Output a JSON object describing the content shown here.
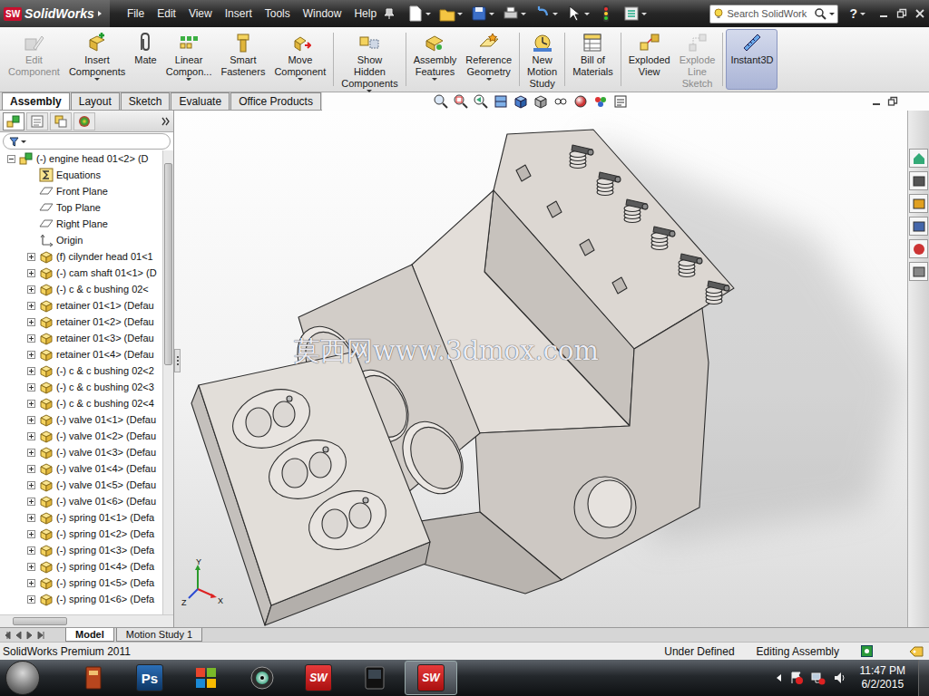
{
  "app": {
    "badge": "SW",
    "name": "SolidWorks"
  },
  "menu": [
    "File",
    "Edit",
    "View",
    "Insert",
    "Tools",
    "Window",
    "Help"
  ],
  "search": {
    "placeholder": "Search SolidWork"
  },
  "help": "?",
  "commands": [
    {
      "lines": [
        "Edit",
        "Component"
      ],
      "kind": "edit",
      "group": 1,
      "dropdown": false,
      "disabled": true,
      "selected": false
    },
    {
      "lines": [
        "Insert",
        "Components"
      ],
      "kind": "insert",
      "group": 1,
      "dropdown": true,
      "disabled": false,
      "selected": false
    },
    {
      "lines": [
        "Mate"
      ],
      "kind": "mate",
      "group": 1,
      "dropdown": false,
      "disabled": false,
      "selected": false
    },
    {
      "lines": [
        "Linear",
        "Compon..."
      ],
      "kind": "pattern",
      "group": 1,
      "dropdown": true,
      "disabled": false,
      "selected": false
    },
    {
      "lines": [
        "Smart",
        "Fasteners"
      ],
      "kind": "fastener",
      "group": 1,
      "dropdown": false,
      "disabled": false,
      "selected": false
    },
    {
      "lines": [
        "Move",
        "Component"
      ],
      "kind": "move",
      "group": 1,
      "dropdown": true,
      "disabled": false,
      "selected": false
    },
    {
      "lines": [
        "Show",
        "Hidden",
        "Components"
      ],
      "kind": "show",
      "group": 2,
      "dropdown": true,
      "disabled": false,
      "selected": false
    },
    {
      "lines": [
        "Assembly",
        "Features"
      ],
      "kind": "features",
      "group": 3,
      "dropdown": true,
      "disabled": false,
      "selected": false
    },
    {
      "lines": [
        "Reference",
        "Geometry"
      ],
      "kind": "reference",
      "group": 3,
      "dropdown": true,
      "disabled": false,
      "selected": false
    },
    {
      "lines": [
        "New",
        "Motion",
        "Study"
      ],
      "kind": "motion",
      "group": 4,
      "dropdown": false,
      "disabled": false,
      "selected": false
    },
    {
      "lines": [
        "Bill of",
        "Materials"
      ],
      "kind": "bom",
      "group": 5,
      "dropdown": false,
      "disabled": false,
      "selected": false
    },
    {
      "lines": [
        "Exploded",
        "View"
      ],
      "kind": "explode",
      "group": 6,
      "dropdown": false,
      "disabled": false,
      "selected": false
    },
    {
      "lines": [
        "Explode",
        "Line",
        "Sketch"
      ],
      "kind": "line",
      "group": 6,
      "dropdown": false,
      "disabled": true,
      "selected": false
    },
    {
      "lines": [
        "Instant3D"
      ],
      "kind": "instant",
      "group": 7,
      "dropdown": false,
      "disabled": false,
      "selected": true
    }
  ],
  "tabs": [
    {
      "label": "Assembly",
      "selected": true
    },
    {
      "label": "Layout",
      "selected": false
    },
    {
      "label": "Sketch",
      "selected": false
    },
    {
      "label": "Evaluate",
      "selected": false
    },
    {
      "label": "Office Products",
      "selected": false
    }
  ],
  "tree": [
    {
      "label": "(-) engine head 01<2> (D",
      "kind": "root",
      "level": 0,
      "expandable": true,
      "expanded": true
    },
    {
      "label": "Equations",
      "kind": "equations",
      "level": 1,
      "expandable": false,
      "expanded": false
    },
    {
      "label": "Front Plane",
      "kind": "plane",
      "level": 1,
      "expandable": false,
      "expanded": false
    },
    {
      "label": "Top Plane",
      "kind": "plane",
      "level": 1,
      "expandable": false,
      "expanded": false
    },
    {
      "label": "Right Plane",
      "kind": "plane",
      "level": 1,
      "expandable": false,
      "expanded": false
    },
    {
      "label": "Origin",
      "kind": "origin",
      "level": 1,
      "expandable": false,
      "expanded": false
    },
    {
      "label": "(f) cilynder head 01<1",
      "kind": "part",
      "level": 1,
      "expandable": true,
      "expanded": false
    },
    {
      "label": "(-) cam shaft 01<1> (D",
      "kind": "part",
      "level": 1,
      "expandable": true,
      "expanded": false
    },
    {
      "label": "(-) c & c bushing 02<",
      "kind": "part",
      "level": 1,
      "expandable": true,
      "expanded": false
    },
    {
      "label": "retainer 01<1> (Defau",
      "kind": "part",
      "level": 1,
      "expandable": true,
      "expanded": false
    },
    {
      "label": "retainer 01<2> (Defau",
      "kind": "part",
      "level": 1,
      "expandable": true,
      "expanded": false
    },
    {
      "label": "retainer 01<3> (Defau",
      "kind": "part",
      "level": 1,
      "expandable": true,
      "expanded": false
    },
    {
      "label": "retainer 01<4> (Defau",
      "kind": "part",
      "level": 1,
      "expandable": true,
      "expanded": false
    },
    {
      "label": "(-) c & c bushing 02<2",
      "kind": "part",
      "level": 1,
      "expandable": true,
      "expanded": false
    },
    {
      "label": "(-) c & c bushing 02<3",
      "kind": "part",
      "level": 1,
      "expandable": true,
      "expanded": false
    },
    {
      "label": "(-) c & c bushing 02<4",
      "kind": "part",
      "level": 1,
      "expandable": true,
      "expanded": false
    },
    {
      "label": "(-) valve 01<1> (Defau",
      "kind": "part",
      "level": 1,
      "expandable": true,
      "expanded": false
    },
    {
      "label": "(-) valve 01<2> (Defau",
      "kind": "part",
      "level": 1,
      "expandable": true,
      "expanded": false
    },
    {
      "label": "(-) valve 01<3> (Defau",
      "kind": "part",
      "level": 1,
      "expandable": true,
      "expanded": false
    },
    {
      "label": "(-) valve 01<4> (Defau",
      "kind": "part",
      "level": 1,
      "expandable": true,
      "expanded": false
    },
    {
      "label": "(-) valve 01<5> (Defau",
      "kind": "part",
      "level": 1,
      "expandable": true,
      "expanded": false
    },
    {
      "label": "(-) valve 01<6> (Defau",
      "kind": "part",
      "level": 1,
      "expandable": true,
      "expanded": false
    },
    {
      "label": "(-) spring 01<1> (Defa",
      "kind": "part",
      "level": 1,
      "expandable": true,
      "expanded": false
    },
    {
      "label": "(-) spring 01<2> (Defa",
      "kind": "part",
      "level": 1,
      "expandable": true,
      "expanded": false
    },
    {
      "label": "(-) spring 01<3> (Defa",
      "kind": "part",
      "level": 1,
      "expandable": true,
      "expanded": false
    },
    {
      "label": "(-) spring 01<4> (Defa",
      "kind": "part",
      "level": 1,
      "expandable": true,
      "expanded": false
    },
    {
      "label": "(-) spring 01<5> (Defa",
      "kind": "part",
      "level": 1,
      "expandable": true,
      "expanded": false
    },
    {
      "label": "(-) spring 01<6> (Defa",
      "kind": "part",
      "level": 1,
      "expandable": true,
      "expanded": false
    }
  ],
  "watermark": "莫西网www.3dmox.com",
  "triad": {
    "y": "Y",
    "x": "X",
    "z": "Z"
  },
  "bottom_tabs": [
    {
      "label": "Model",
      "selected": true
    },
    {
      "label": "Motion Study 1",
      "selected": false
    }
  ],
  "status_bar": {
    "product": "SolidWorks Premium 2011",
    "state": "Under Defined",
    "mode": "Editing Assembly"
  },
  "taskbar": {
    "apps": [
      {
        "kind": "book",
        "label": "",
        "active": false
      },
      {
        "kind": "photoshop",
        "label": "Ps",
        "active": false
      },
      {
        "kind": "office",
        "label": "",
        "active": false
      },
      {
        "kind": "disc",
        "label": "",
        "active": false
      },
      {
        "kind": "solidworks",
        "label": "SW",
        "active": false
      },
      {
        "kind": "monitor",
        "label": "",
        "active": false
      },
      {
        "kind": "solidworks",
        "label": "SW",
        "active": true
      }
    ],
    "time": "11:47 PM",
    "date": "6/2/2015"
  }
}
